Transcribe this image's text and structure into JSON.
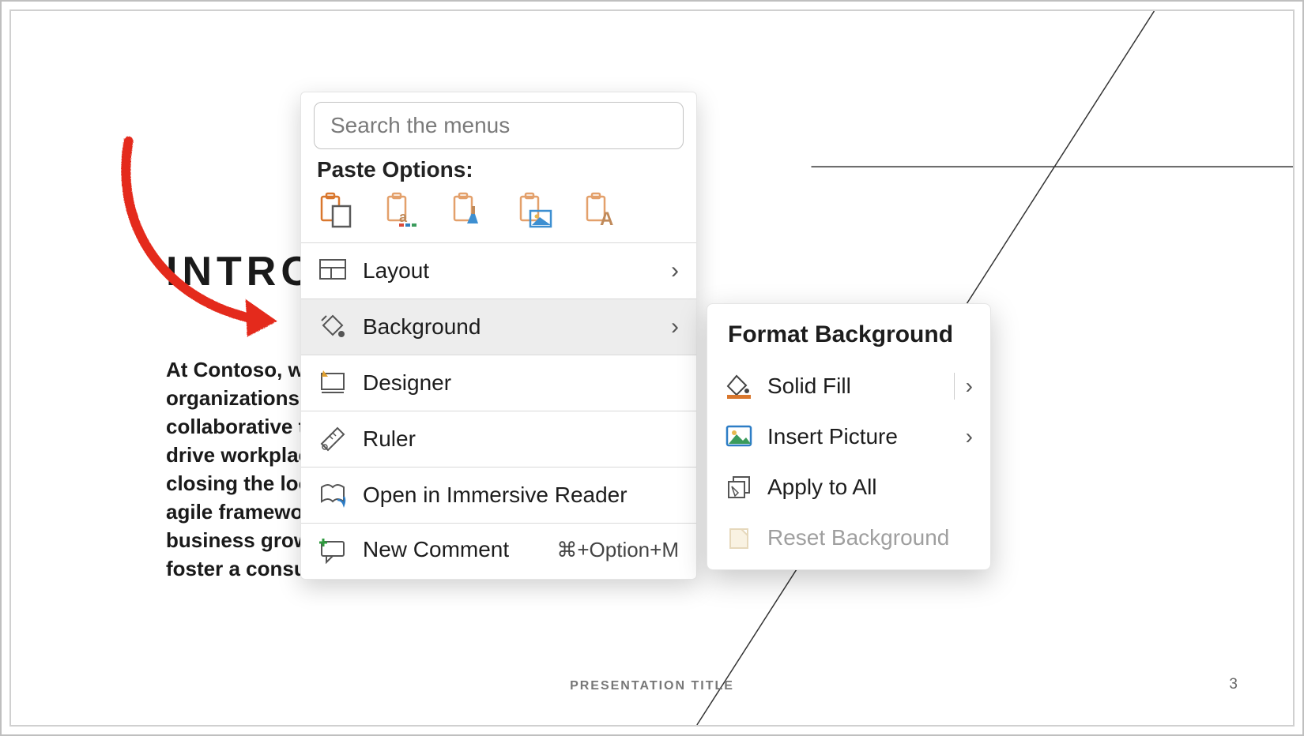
{
  "slide": {
    "title": "INTRODUCTION",
    "body": "At Contoso, we empower organizations to foster collaborative thinking to further drive workplace innovation. By closing the loop and leveraging agile frameworks, we help business grow organically and foster a consumer-first mindset.",
    "footer_title": "PRESENTATION TITLE",
    "page_number": "3"
  },
  "context_menu": {
    "search_placeholder": "Search the menus",
    "paste_options_label": "Paste Options:",
    "items": {
      "layout": "Layout",
      "background": "Background",
      "designer": "Designer",
      "ruler": "Ruler",
      "immersive": "Open in Immersive Reader",
      "new_comment": "New Comment",
      "new_comment_shortcut": "⌘+Option+M"
    }
  },
  "submenu": {
    "title": "Format Background",
    "solid_fill": "Solid Fill",
    "insert_picture": "Insert Picture",
    "apply_all": "Apply to All",
    "reset": "Reset Background"
  }
}
